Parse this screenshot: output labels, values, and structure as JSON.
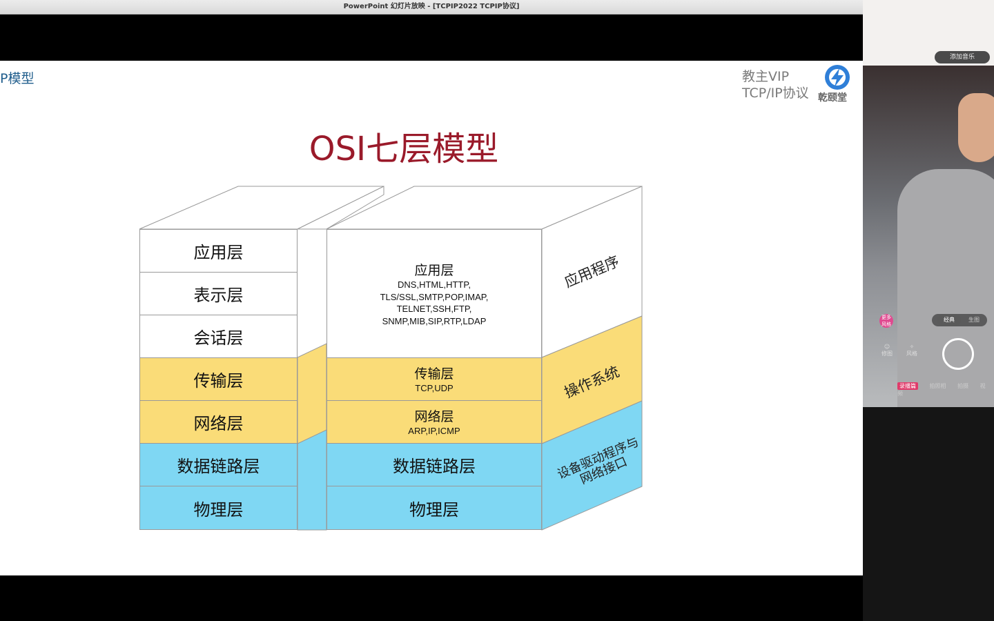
{
  "window": {
    "title": "PowerPoint 幻灯片放映 - [TCPIP2022 TCPIP协议]"
  },
  "slide": {
    "corner_title": "P模型",
    "brand_line1": "教主VIP",
    "brand_line2": "TCP/IP协议",
    "logo_text": "乾颐堂",
    "title": "OSI七层模型",
    "osi_layers": [
      "应用层",
      "表示层",
      "会话层",
      "传输层",
      "网络层",
      "数据链路层",
      "物理层"
    ],
    "tcpip_app_name": "应用层",
    "tcpip_app_protocols": [
      "DNS,HTML,HTTP,",
      "TLS/SSL,SMTP,POP,IMAP,",
      "TELNET,SSH,FTP,",
      "SNMP,MIB,SIP,RTP,LDAP"
    ],
    "tcpip_transport_name": "传输层",
    "tcpip_transport_protocols": "TCP,UDP",
    "tcpip_network_name": "网络层",
    "tcpip_network_protocols": "ARP,IP,ICMP",
    "tcpip_datalink": "数据链路层",
    "tcpip_physical": "物理层",
    "side_labels": [
      "应用程序",
      "操作系统",
      "设备驱动程序与",
      "网络接口"
    ],
    "colors": {
      "upper": "#ffffff",
      "middle": "#fadc78",
      "lower": "#7fd7f3",
      "title": "#9a1a2a"
    }
  },
  "camera": {
    "music_button": "添加音乐",
    "mode_selected": "经典",
    "mode_other": "生图",
    "badge": "更多风格",
    "tools": [
      "修图",
      "风格"
    ],
    "tabs": [
      "录播篇",
      "拍照相",
      "拍摄",
      "视频"
    ]
  }
}
